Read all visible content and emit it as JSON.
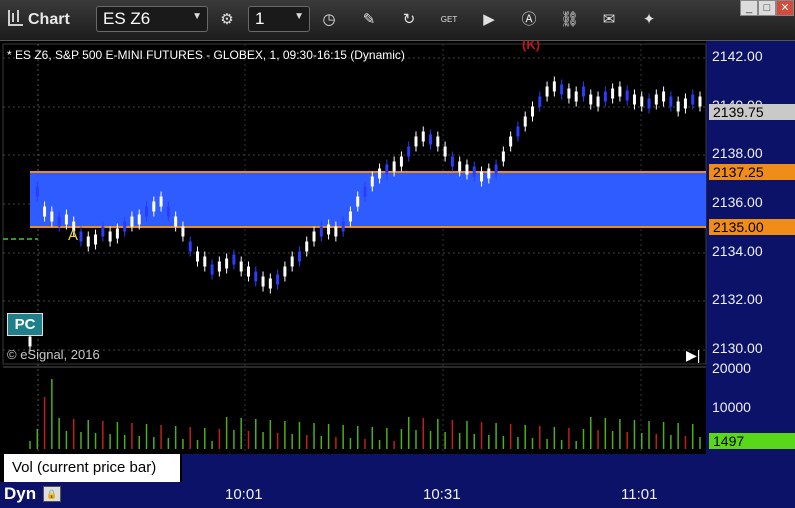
{
  "window": {
    "title": "Chart",
    "symbol_input": "ES Z6",
    "interval_input": "1",
    "controls": {
      "minimize": "_",
      "maximize": "□",
      "close": "✕"
    }
  },
  "toolbar_icons": [
    "settings-gear-icon",
    "clock-icon",
    "pencil-icon",
    "refresh-icon",
    "get-icon",
    "play-icon",
    "alert-icon",
    "link-icon",
    "comment-icon",
    "twitter-icon"
  ],
  "chart": {
    "symbol_line": "* ES Z6, S&P 500 E-MINI FUTURES - GLOBEX, 1, 09:30-16:15 (Dynamic)",
    "copyright": "© eSignal, 2016",
    "pc_badge": "PC",
    "marker_a": "A",
    "marker_k": "(K)",
    "price_ticks": [
      "2142.00",
      "2140.00",
      "2138.00",
      "2136.00",
      "2134.00",
      "2132.00",
      "2130.00"
    ],
    "last_price_tag": "2139.75",
    "upper_level_tag": "2137.25",
    "lower_level_tag": "2135.00",
    "volume_ticks": [
      "20000",
      "10000",
      "0"
    ],
    "volume_tag": "1497",
    "volume_study_label": "Vol (current price bar)",
    "volume_close": "×",
    "footer_mode": "Dyn",
    "time_labels": [
      "10:01",
      "10:31",
      "11:01"
    ]
  },
  "colors": {
    "background": "#000000",
    "axis_panel": "#0b1268",
    "range_band": "#2f5cff",
    "level_line": "#f08c18",
    "up_candle": "#ffffff",
    "down_candle": "#2a3cff",
    "volume_up": "#4caf1f",
    "volume_down": "#c0201a"
  }
}
